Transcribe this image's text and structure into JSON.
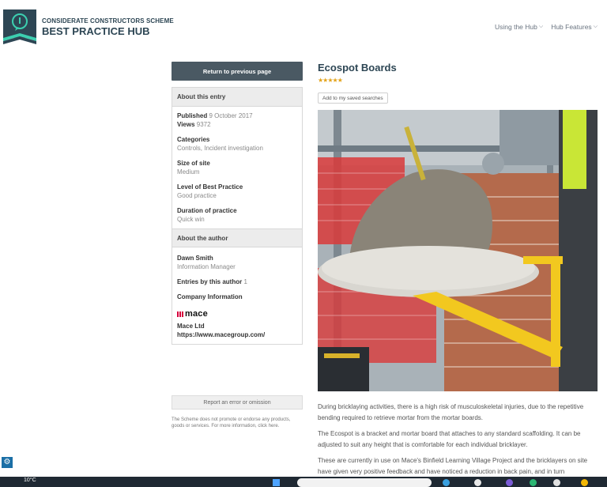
{
  "brand": {
    "top": "CONSIDERATE CONSTRUCTORS SCHEME",
    "main": "BEST PRACTICE HUB"
  },
  "nav": {
    "items": [
      {
        "label": "Using the Hub"
      },
      {
        "label": "Hub Features"
      }
    ]
  },
  "sidebar": {
    "return_label": "Return to previous page",
    "about_entry": {
      "heading": "About this entry",
      "published_label": "Published",
      "published_value": "9 October 2017",
      "views_label": "Views",
      "views_value": "9372",
      "categories_label": "Categories",
      "categories_value": "Controls, Incident investigation",
      "size_label": "Size of site",
      "size_value": "Medium",
      "level_label": "Level of Best Practice",
      "level_value": "Good practice",
      "duration_label": "Duration of practice",
      "duration_value": "Quick win"
    },
    "about_author": {
      "heading": "About the author",
      "name": "Dawn Smith",
      "role": "Information Manager",
      "entries_label": "Entries by this author",
      "entries_value": "1",
      "company_label": "Company Information",
      "company_logo_text": "mace",
      "company_name": "Mace Ltd",
      "company_url": "https://www.macegroup.com/"
    },
    "report_label": "Report an error or omission",
    "disclaimer": "The Scheme does not promote or endorse any products, goods or services. For more information, click here."
  },
  "main": {
    "title": "Ecospot Boards",
    "rating": 5,
    "stars": "★★★★★",
    "save_label": "Add to my saved searches",
    "paragraphs": [
      "During bricklaying activities, there is a high risk of musculoskeletal injuries, due to the repetitive bending required to retrieve mortar from the mortar boards.",
      "The Ecospot is a bracket and mortar board that attaches to any standard scaffolding. It can be adjusted to suit any height that is comfortable for each individual bricklayer.",
      "These are currently in use on Mace's Binfield Learning Village Project and the bricklayers on site have given very positive feedback and have noticed a reduction in back pain, and in turn"
    ]
  },
  "taskbar": {
    "weather": "10°C"
  },
  "colors": {
    "brand_navy": "#2d4654",
    "button_dark": "#4a5963",
    "star_gold": "#e3a31a",
    "mace_red": "#d6003b"
  }
}
